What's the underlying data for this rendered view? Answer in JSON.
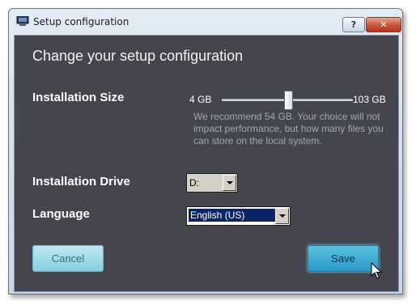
{
  "window": {
    "title": "Setup configuration",
    "help_button": "?",
    "close_button": "✕"
  },
  "dialog": {
    "heading": "Change your setup configuration",
    "installation_size": {
      "label": "Installation Size",
      "min_label": "4 GB",
      "max_label": "103 GB",
      "min_gb": 4,
      "max_gb": 103,
      "value_gb": 54,
      "hint": "We recommend 54 GB. Your choice will not impact performance, but how many files you can store on the local system."
    },
    "installation_drive": {
      "label": "Installation Drive",
      "selected": "D:"
    },
    "language": {
      "label": "Language",
      "selected": "English (US)"
    },
    "buttons": {
      "cancel": "Cancel",
      "save": "Save"
    }
  },
  "colors": {
    "client_background": "#44454d",
    "cancel_button": "#a6dfee",
    "save_button": "#3aa9d6"
  }
}
